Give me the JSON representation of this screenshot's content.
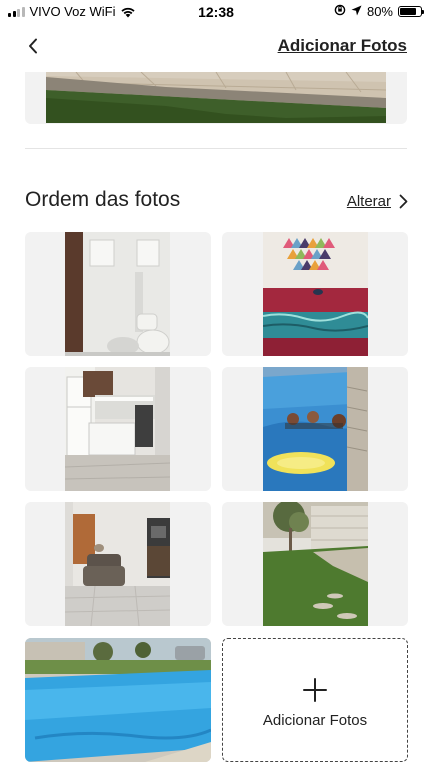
{
  "status_bar": {
    "carrier": "VIVO Voz WiFi",
    "time": "12:38",
    "battery": "80%",
    "battery_level": 0.8
  },
  "nav": {
    "back_icon": "chevron-left-icon",
    "add_photos_label": "Adicionar Fotos"
  },
  "photo_order": {
    "title": "Ordem das fotos",
    "alter_label": "Alterar",
    "alter_icon": "chevron-right-icon",
    "photos": [
      {
        "subject": "bathroom"
      },
      {
        "subject": "bedroom"
      },
      {
        "subject": "kitchen"
      },
      {
        "subject": "pool-with-children"
      },
      {
        "subject": "living-room"
      },
      {
        "subject": "garden"
      },
      {
        "subject": "pool"
      }
    ],
    "add_tile_label": "Adicionar Fotos",
    "add_tile_icon": "plus-icon"
  },
  "colors": {
    "text": "#222222",
    "tile_background": "#f2f2f2",
    "divider": "#e4e4e4"
  }
}
